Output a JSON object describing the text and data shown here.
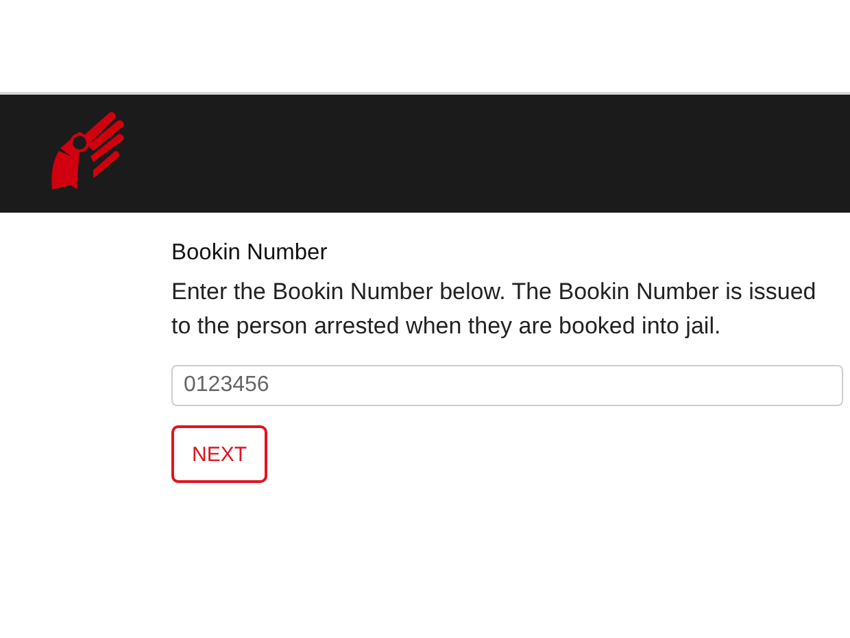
{
  "form": {
    "heading": "Bookin Number",
    "description": "Enter the Bookin Number below. The Bookin Number is issued to the person arrested when they are booked into jail.",
    "field": {
      "placeholder": "0123456"
    },
    "button": "NEXT"
  }
}
